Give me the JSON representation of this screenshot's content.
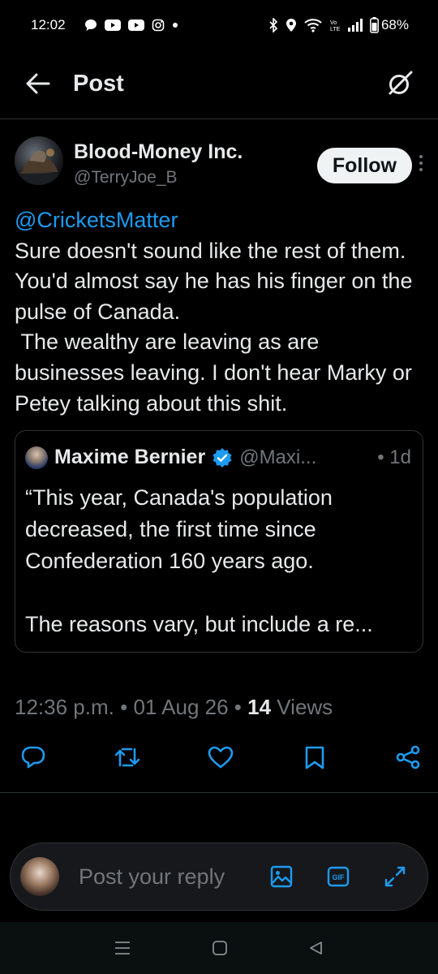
{
  "status_bar": {
    "time": "12:02",
    "battery": "68%",
    "notification_icons": [
      "chat-bubble-icon",
      "youtube-icon",
      "youtube-icon",
      "instagram-icon",
      "dot-icon"
    ],
    "system_icons": [
      "bluetooth-icon",
      "location-icon",
      "wifi-icon",
      "volte-icon",
      "signal-icon",
      "battery-icon"
    ]
  },
  "header": {
    "back_icon": "arrow-left-icon",
    "title": "Post",
    "grok_icon": "grok-icon"
  },
  "post": {
    "author": {
      "display_name": "Blood-Money Inc.",
      "handle": "@TerryJoe_B"
    },
    "follow_label": "Follow",
    "mention": "@CricketsMatter",
    "text": "Sure doesn't sound like the rest of them. You'd almost say he has his finger on the pulse of Canada.\n The wealthy are leaving as are businesses leaving. I don't hear Marky or Petey talking about this shit.",
    "quote": {
      "name": "Maxime Bernier",
      "handle": "@Maxi...",
      "time": "• 1d",
      "text": "“This year, Canada's population decreased, the first time since Confederation 160 years ago.\n\nThe reasons vary, but include a re..."
    },
    "meta": {
      "time": "12:36 p.m.",
      "sep1": "•",
      "date": "01 Aug 26",
      "sep2": "•",
      "views_count": "14",
      "views_label": "Views"
    }
  },
  "actions": [
    "reply-icon",
    "repost-icon",
    "like-icon",
    "bookmark-icon",
    "share-icon"
  ],
  "reply_bar": {
    "placeholder": "Post your reply",
    "icons": [
      "image-icon",
      "gif-icon",
      "expand-icon"
    ]
  },
  "colors": {
    "background": "#000000",
    "text": "#e7e9ea",
    "muted": "#71767b",
    "accent": "#1d9bf0",
    "border": "#2f3336"
  }
}
